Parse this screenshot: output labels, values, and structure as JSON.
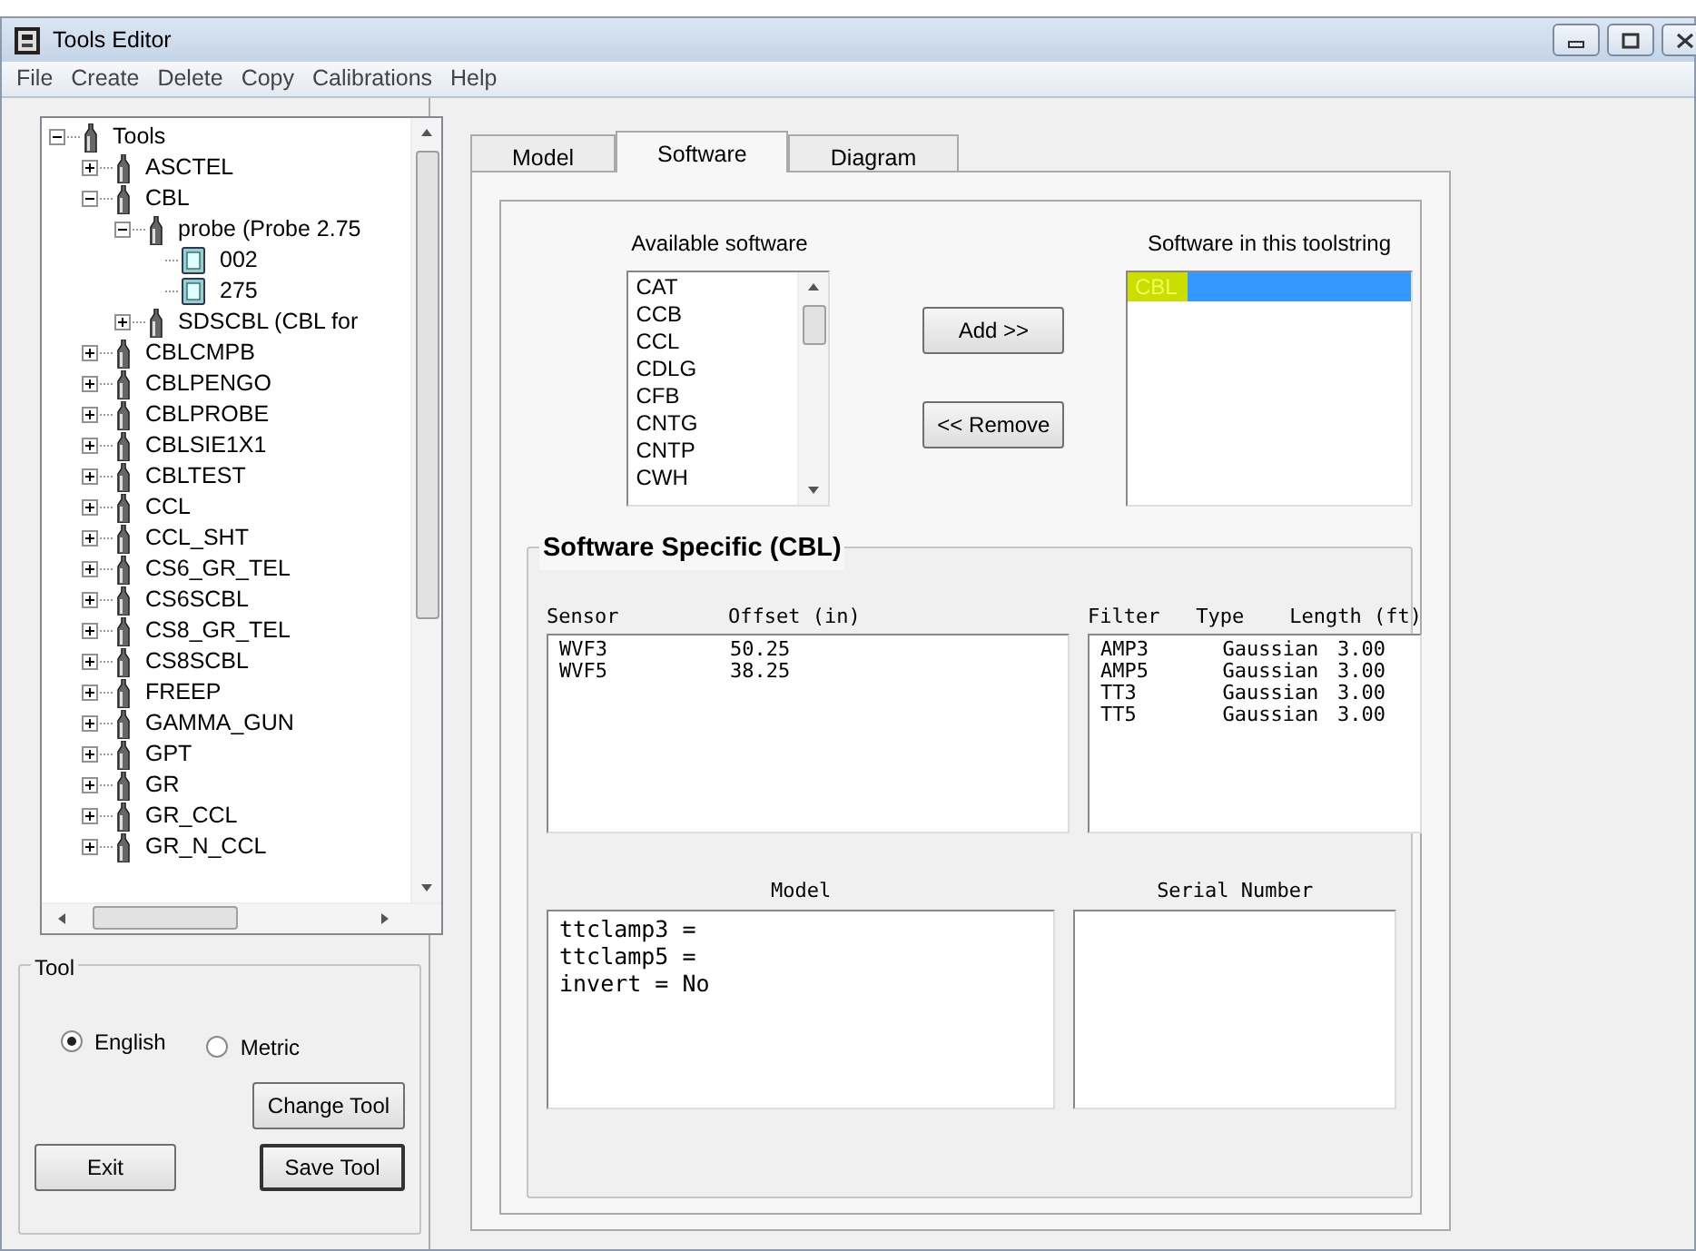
{
  "window": {
    "title": "Tools Editor"
  },
  "menu": [
    "File",
    "Create",
    "Delete",
    "Copy",
    "Calibrations",
    "Help"
  ],
  "tree": [
    {
      "label": "Tools",
      "kind": "tool",
      "expanded": true,
      "children": [
        {
          "label": "ASCTEL",
          "kind": "tool",
          "expanded": false
        },
        {
          "label": "CBL",
          "kind": "tool",
          "expanded": true,
          "children": [
            {
              "label": "probe (Probe 2.75",
              "kind": "tool",
              "expanded": true,
              "children": [
                {
                  "label": "002",
                  "kind": "calibration"
                },
                {
                  "label": "275",
                  "kind": "calibration"
                }
              ]
            },
            {
              "label": "SDSCBL (CBL for",
              "kind": "tool",
              "expanded": false
            }
          ]
        },
        {
          "label": "CBLCMPB",
          "kind": "tool",
          "expanded": false
        },
        {
          "label": "CBLPENGO",
          "kind": "tool",
          "expanded": false
        },
        {
          "label": "CBLPROBE",
          "kind": "tool",
          "expanded": false
        },
        {
          "label": "CBLSIE1X1",
          "kind": "tool",
          "expanded": false
        },
        {
          "label": "CBLTEST",
          "kind": "tool",
          "expanded": false
        },
        {
          "label": "CCL",
          "kind": "tool",
          "expanded": false
        },
        {
          "label": "CCL_SHT",
          "kind": "tool",
          "expanded": false
        },
        {
          "label": "CS6_GR_TEL",
          "kind": "tool",
          "expanded": false
        },
        {
          "label": "CS6SCBL",
          "kind": "tool",
          "expanded": false
        },
        {
          "label": "CS8_GR_TEL",
          "kind": "tool",
          "expanded": false
        },
        {
          "label": "CS8SCBL",
          "kind": "tool",
          "expanded": false
        },
        {
          "label": "FREEP",
          "kind": "tool",
          "expanded": false
        },
        {
          "label": "GAMMA_GUN",
          "kind": "tool",
          "expanded": false
        },
        {
          "label": "GPT",
          "kind": "tool",
          "expanded": false
        },
        {
          "label": "GR",
          "kind": "tool",
          "expanded": false
        },
        {
          "label": "GR_CCL",
          "kind": "tool",
          "expanded": false
        },
        {
          "label": "GR_N_CCL",
          "kind": "tool",
          "expanded": false
        }
      ]
    }
  ],
  "tool_group": {
    "title": "Tool",
    "units": [
      {
        "label": "English",
        "selected": true
      },
      {
        "label": "Metric",
        "selected": false
      }
    ],
    "change_button": "Change Tool",
    "exit_button": "Exit",
    "save_button": "Save Tool"
  },
  "tabs": [
    {
      "label": "Model",
      "selected": false
    },
    {
      "label": "Software",
      "selected": true
    },
    {
      "label": "Diagram",
      "selected": false
    }
  ],
  "available_software": {
    "label": "Available software",
    "items": [
      "CAT",
      "CCB",
      "CCL",
      "CDLG",
      "CFB",
      "CNTG",
      "CNTP",
      "CWH"
    ]
  },
  "add_button": "Add >>",
  "remove_button": "<< Remove",
  "toolstring_software": {
    "label": "Software in this toolstring",
    "items": [
      {
        "label": "CBL",
        "selected": true,
        "highlighted": true
      }
    ]
  },
  "software_specific": {
    "title": "Software Specific (CBL)",
    "sensor_columns": [
      "Sensor",
      "Offset (in)"
    ],
    "sensor_rows": [
      [
        "WVF3",
        "50.25"
      ],
      [
        "WVF5",
        "38.25"
      ]
    ],
    "filter_columns": [
      "Filter",
      "Type",
      "Length (ft)"
    ],
    "filter_rows": [
      [
        "AMP3",
        "Gaussian",
        "3.00"
      ],
      [
        "AMP5",
        "Gaussian",
        "3.00"
      ],
      [
        "TT3",
        "Gaussian",
        "3.00"
      ],
      [
        "TT5",
        "Gaussian",
        "3.00"
      ]
    ],
    "model_label": "Model",
    "model_lines": [
      "ttclamp3 =",
      "ttclamp5 =",
      "invert = No"
    ],
    "serial_label": "Serial Number"
  }
}
